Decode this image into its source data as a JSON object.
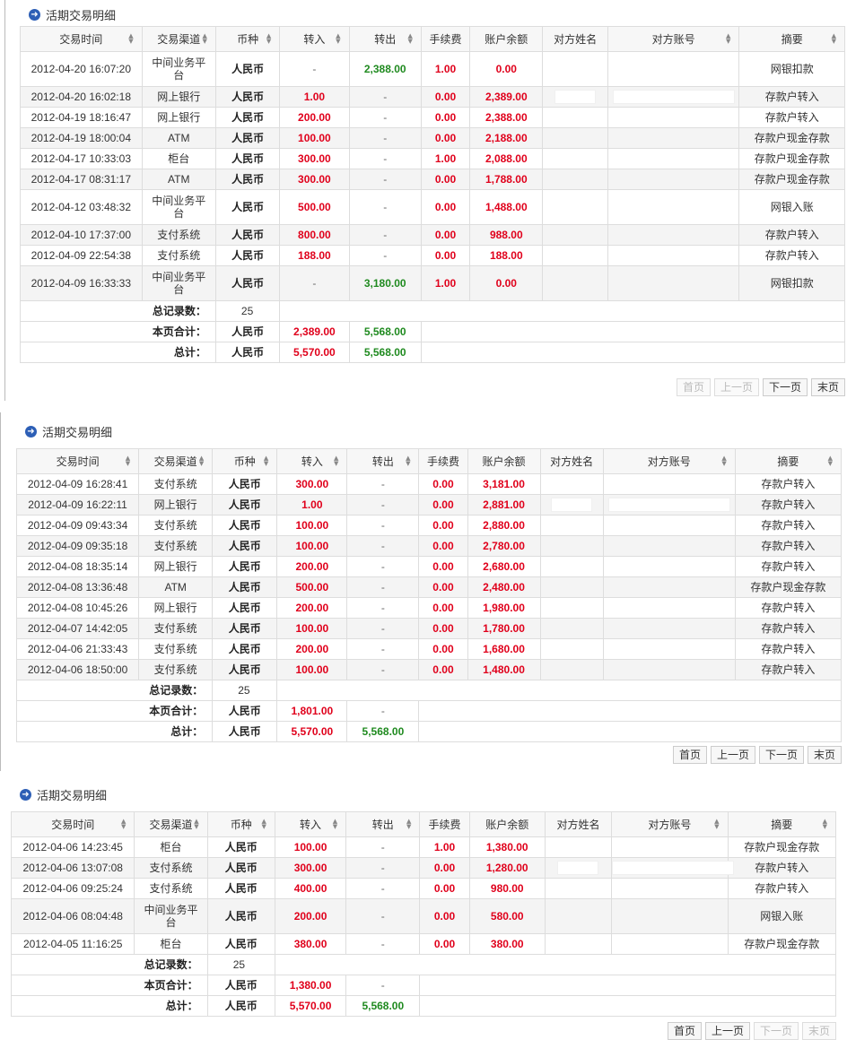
{
  "section_title": "活期交易明细",
  "columns": [
    "交易时间",
    "交易渠道",
    "币种",
    "转入",
    "转出",
    "手续费",
    "账户余额",
    "对方姓名",
    "对方账号",
    "摘要"
  ],
  "summary_labels": {
    "count": "总记录数：",
    "page_total": "本页合计：",
    "grand_total": "总计："
  },
  "pager_labels": {
    "first": "首页",
    "prev": "上一页",
    "next": "下一页",
    "last": "末页"
  },
  "sections": [
    {
      "rows": [
        [
          "2012-04-20 16:07:20",
          "中间业务平台",
          "人民币",
          "-",
          "2,388.00",
          "1.00",
          "0.00",
          "",
          "",
          "网银扣款"
        ],
        [
          "2012-04-20 16:02:18",
          "网上银行",
          "人民币",
          "1.00",
          "-",
          "0.00",
          "2,389.00",
          "",
          "",
          "存款户转入"
        ],
        [
          "2012-04-19 18:16:47",
          "网上银行",
          "人民币",
          "200.00",
          "-",
          "0.00",
          "2,388.00",
          "",
          "",
          "存款户转入"
        ],
        [
          "2012-04-19 18:00:04",
          "ATM",
          "人民币",
          "100.00",
          "-",
          "0.00",
          "2,188.00",
          "",
          "",
          "存款户现金存款"
        ],
        [
          "2012-04-17 10:33:03",
          "柜台",
          "人民币",
          "300.00",
          "-",
          "1.00",
          "2,088.00",
          "",
          "",
          "存款户现金存款"
        ],
        [
          "2012-04-17 08:31:17",
          "ATM",
          "人民币",
          "300.00",
          "-",
          "0.00",
          "1,788.00",
          "",
          "",
          "存款户现金存款"
        ],
        [
          "2012-04-12 03:48:32",
          "中间业务平台",
          "人民币",
          "500.00",
          "-",
          "0.00",
          "1,488.00",
          "",
          "",
          "网银入账"
        ],
        [
          "2012-04-10 17:37:00",
          "支付系统",
          "人民币",
          "800.00",
          "-",
          "0.00",
          "988.00",
          "",
          "",
          "存款户转入"
        ],
        [
          "2012-04-09 22:54:38",
          "支付系统",
          "人民币",
          "188.00",
          "-",
          "0.00",
          "188.00",
          "",
          "",
          "存款户转入"
        ],
        [
          "2012-04-09 16:33:33",
          "中间业务平台",
          "人民币",
          "-",
          "3,180.00",
          "1.00",
          "0.00",
          "",
          "",
          "网银扣款"
        ]
      ],
      "count": "25",
      "page_total": {
        "currency": "人民币",
        "in": "2,389.00",
        "out": "5,568.00"
      },
      "grand_total": {
        "currency": "人民币",
        "in": "5,570.00",
        "out": "5,568.00"
      },
      "pager_disabled": [
        "first",
        "prev"
      ]
    },
    {
      "rows": [
        [
          "2012-04-09 16:28:41",
          "支付系统",
          "人民币",
          "300.00",
          "-",
          "0.00",
          "3,181.00",
          "",
          "",
          "存款户转入"
        ],
        [
          "2012-04-09 16:22:11",
          "网上银行",
          "人民币",
          "1.00",
          "-",
          "0.00",
          "2,881.00",
          "",
          "",
          "存款户转入"
        ],
        [
          "2012-04-09 09:43:34",
          "支付系统",
          "人民币",
          "100.00",
          "-",
          "0.00",
          "2,880.00",
          "",
          "",
          "存款户转入"
        ],
        [
          "2012-04-09 09:35:18",
          "支付系统",
          "人民币",
          "100.00",
          "-",
          "0.00",
          "2,780.00",
          "",
          "",
          "存款户转入"
        ],
        [
          "2012-04-08 18:35:14",
          "网上银行",
          "人民币",
          "200.00",
          "-",
          "0.00",
          "2,680.00",
          "",
          "",
          "存款户转入"
        ],
        [
          "2012-04-08 13:36:48",
          "ATM",
          "人民币",
          "500.00",
          "-",
          "0.00",
          "2,480.00",
          "",
          "",
          "存款户现金存款"
        ],
        [
          "2012-04-08 10:45:26",
          "网上银行",
          "人民币",
          "200.00",
          "-",
          "0.00",
          "1,980.00",
          "",
          "",
          "存款户转入"
        ],
        [
          "2012-04-07 14:42:05",
          "支付系统",
          "人民币",
          "100.00",
          "-",
          "0.00",
          "1,780.00",
          "",
          "",
          "存款户转入"
        ],
        [
          "2012-04-06 21:33:43",
          "支付系统",
          "人民币",
          "200.00",
          "-",
          "0.00",
          "1,680.00",
          "",
          "",
          "存款户转入"
        ],
        [
          "2012-04-06 18:50:00",
          "支付系统",
          "人民币",
          "100.00",
          "-",
          "0.00",
          "1,480.00",
          "",
          "",
          "存款户转入"
        ]
      ],
      "count": "25",
      "page_total": {
        "currency": "人民币",
        "in": "1,801.00",
        "out": "-"
      },
      "grand_total": {
        "currency": "人民币",
        "in": "5,570.00",
        "out": "5,568.00"
      },
      "pager_disabled": []
    },
    {
      "rows": [
        [
          "2012-04-06 14:23:45",
          "柜台",
          "人民币",
          "100.00",
          "-",
          "1.00",
          "1,380.00",
          "",
          "",
          "存款户现金存款"
        ],
        [
          "2012-04-06 13:07:08",
          "支付系统",
          "人民币",
          "300.00",
          "-",
          "0.00",
          "1,280.00",
          "",
          "",
          "存款户转入"
        ],
        [
          "2012-04-06 09:25:24",
          "支付系统",
          "人民币",
          "400.00",
          "-",
          "0.00",
          "980.00",
          "",
          "",
          "存款户转入"
        ],
        [
          "2012-04-06 08:04:48",
          "中间业务平台",
          "人民币",
          "200.00",
          "-",
          "0.00",
          "580.00",
          "",
          "",
          "网银入账"
        ],
        [
          "2012-04-05 11:16:25",
          "柜台",
          "人民币",
          "380.00",
          "-",
          "0.00",
          "380.00",
          "",
          "",
          "存款户现金存款"
        ]
      ],
      "count": "25",
      "page_total": {
        "currency": "人民币",
        "in": "1,380.00",
        "out": "-"
      },
      "grand_total": {
        "currency": "人民币",
        "in": "5,570.00",
        "out": "5,568.00"
      },
      "pager_disabled": [
        "next",
        "last"
      ]
    }
  ],
  "colors": {
    "in": "#e0001b",
    "out": "#1f8a1f",
    "title_icon": "#2d5fb6",
    "row_alt": "#f4f4f4"
  }
}
